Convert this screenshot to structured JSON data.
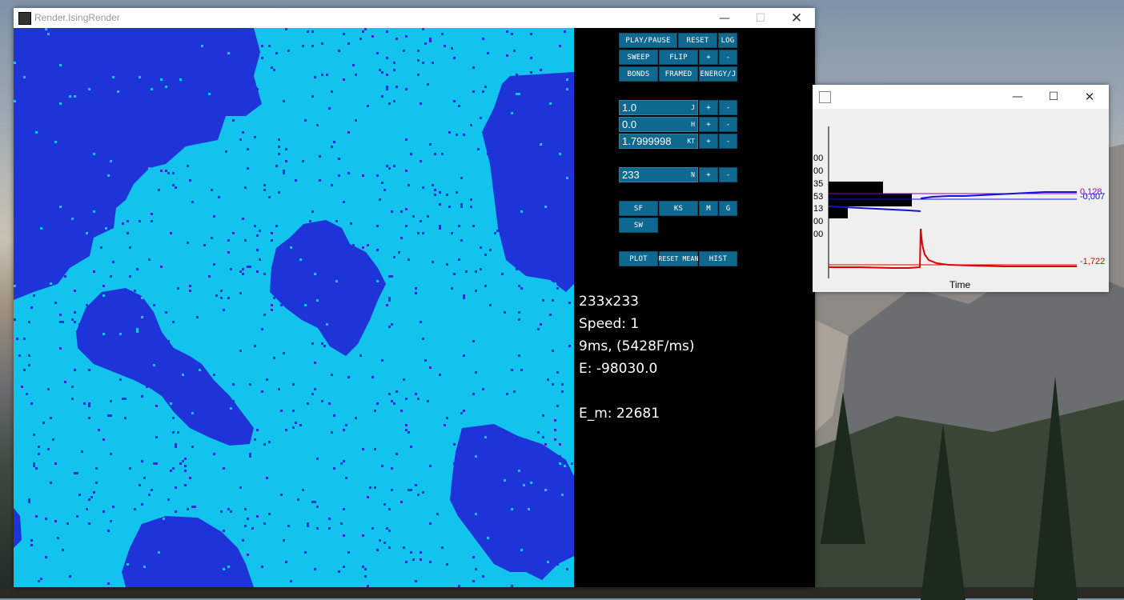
{
  "main_window": {
    "title": "Render.IsingRender",
    "buttons": {
      "play_pause": "PLAY/PAUSE",
      "reset": "RESET",
      "log": "LOG",
      "sweep": "SWEEP",
      "flip": "FLIP",
      "plus": "+",
      "minus": "-",
      "bonds": "BONDS",
      "framed": "FRAMED",
      "energy_j": "ENERGY/J",
      "sf": "SF",
      "ks": "KS",
      "m": "M",
      "g": "G",
      "sw": "SW",
      "plot": "PLOT",
      "reset_mean": "RESET MEAN",
      "hist": "HIST"
    },
    "fields": {
      "j": {
        "value": "1.0",
        "unit": "J"
      },
      "h": {
        "value": "0.0",
        "unit": "H"
      },
      "kt": {
        "value": "1.7999998",
        "unit": "KT"
      },
      "n": {
        "value": "233",
        "unit": "N"
      }
    },
    "stats": {
      "size": "233x233",
      "speed": "Speed: 1",
      "timing": "9ms, (5428F/ms)",
      "energy": "E: -98030.0",
      "e_m": "E_m: 22681"
    },
    "colors": {
      "spin_up": "#12c3ee",
      "spin_down": "#1f34d8",
      "panel_bg": "#000000",
      "button": "#0f6890"
    }
  },
  "plot_window": {
    "y_ticks": [
      "00",
      "00",
      "35",
      "53",
      "13",
      "00",
      "00"
    ],
    "x_axis_label": "Time",
    "right_labels": {
      "top": "0,128",
      "mid": "-0,007",
      "bottom": "-1,722"
    },
    "colors": {
      "series_top": "#9b00c8",
      "series_mid": "#1212d8",
      "series_bottom": "#e00000"
    }
  }
}
